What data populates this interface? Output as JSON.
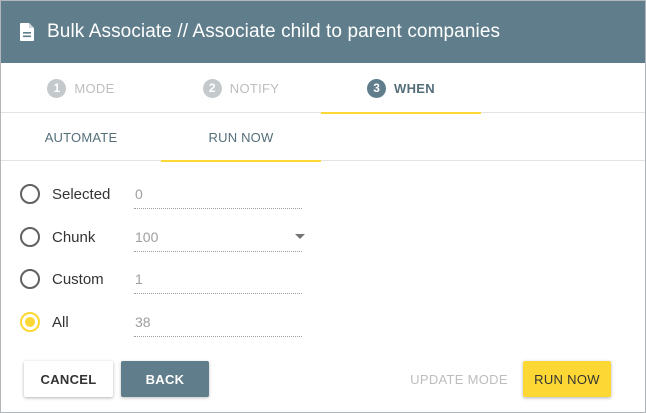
{
  "header": {
    "title": "Bulk Associate // Associate child to parent companies",
    "icon": "document-icon"
  },
  "steps": [
    {
      "num": "1",
      "label": "MODE",
      "active": false
    },
    {
      "num": "2",
      "label": "NOTIFY",
      "active": false
    },
    {
      "num": "3",
      "label": "WHEN",
      "active": true
    }
  ],
  "subtabs": [
    {
      "label": "AUTOMATE",
      "active": false
    },
    {
      "label": "RUN NOW",
      "active": true
    }
  ],
  "options": [
    {
      "label": "Selected",
      "value": "0",
      "checked": false
    },
    {
      "label": "Chunk",
      "value": "100",
      "checked": false,
      "dropdown": true
    },
    {
      "label": "Custom",
      "value": "1",
      "checked": false
    },
    {
      "label": "All",
      "value": "38",
      "checked": true
    }
  ],
  "buttons": {
    "cancel": "CANCEL",
    "back": "BACK",
    "update_mode": "UPDATE MODE",
    "run_now": "RUN NOW"
  },
  "colors": {
    "header": "#607d8b",
    "accent": "#fdd835",
    "step_inactive": "#c4c9cc"
  }
}
